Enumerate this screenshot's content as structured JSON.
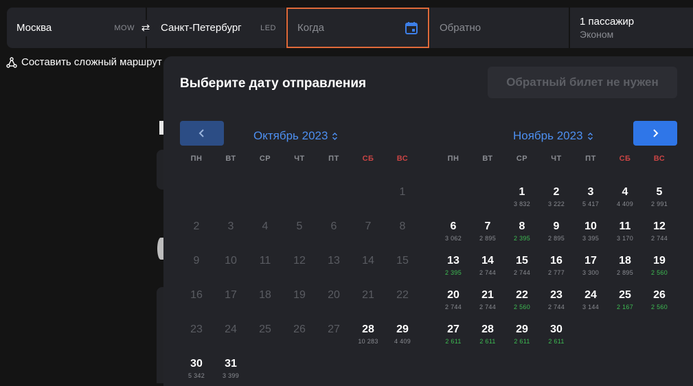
{
  "search": {
    "origin": {
      "city": "Москва",
      "code": "MOW"
    },
    "destination": {
      "city": "Санкт-Петербург",
      "code": "LED"
    },
    "when_placeholder": "Когда",
    "return_placeholder": "Обратно",
    "passengers": {
      "count_label": "1 пассажир",
      "class_label": "Эконом"
    },
    "swap_icon": "⇄",
    "complex_route_label": "Составить сложный маршрут"
  },
  "calendar": {
    "title": "Выберите дату отправления",
    "no_return_label": "Обратный билет не нужен",
    "weekdays": [
      "ПН",
      "ВТ",
      "СР",
      "ЧТ",
      "ПТ",
      "СБ",
      "ВС"
    ],
    "accent_color": "#4d8ff0",
    "price_cheap_color": "#3dbb52",
    "weekend_color": "#c94444",
    "months": [
      {
        "title": "Октябрь 2023",
        "weeks": [
          [
            null,
            null,
            null,
            null,
            null,
            null,
            {
              "d": "1",
              "disabled": true
            }
          ],
          [
            {
              "d": "2",
              "disabled": true
            },
            {
              "d": "3",
              "disabled": true
            },
            {
              "d": "4",
              "disabled": true
            },
            {
              "d": "5",
              "disabled": true
            },
            {
              "d": "6",
              "disabled": true
            },
            {
              "d": "7",
              "disabled": true
            },
            {
              "d": "8",
              "disabled": true
            }
          ],
          [
            {
              "d": "9",
              "disabled": true
            },
            {
              "d": "10",
              "disabled": true
            },
            {
              "d": "11",
              "disabled": true
            },
            {
              "d": "12",
              "disabled": true
            },
            {
              "d": "13",
              "disabled": true
            },
            {
              "d": "14",
              "disabled": true
            },
            {
              "d": "15",
              "disabled": true
            }
          ],
          [
            {
              "d": "16",
              "disabled": true
            },
            {
              "d": "17",
              "disabled": true
            },
            {
              "d": "18",
              "disabled": true
            },
            {
              "d": "19",
              "disabled": true
            },
            {
              "d": "20",
              "disabled": true
            },
            {
              "d": "21",
              "disabled": true
            },
            {
              "d": "22",
              "disabled": true
            }
          ],
          [
            {
              "d": "23",
              "disabled": true
            },
            {
              "d": "24",
              "disabled": true
            },
            {
              "d": "25",
              "disabled": true
            },
            {
              "d": "26",
              "disabled": true
            },
            {
              "d": "27",
              "disabled": true
            },
            {
              "d": "28",
              "p": "10 283"
            },
            {
              "d": "29",
              "p": "4 409"
            }
          ],
          [
            {
              "d": "30",
              "p": "5 342"
            },
            {
              "d": "31",
              "p": "3 399"
            },
            null,
            null,
            null,
            null,
            null
          ]
        ]
      },
      {
        "title": "Ноябрь 2023",
        "weeks": [
          [
            null,
            null,
            {
              "d": "1",
              "p": "3 832"
            },
            {
              "d": "2",
              "p": "3 222"
            },
            {
              "d": "3",
              "p": "5 417"
            },
            {
              "d": "4",
              "p": "4 409"
            },
            {
              "d": "5",
              "p": "2 991"
            }
          ],
          [
            {
              "d": "6",
              "p": "3 062"
            },
            {
              "d": "7",
              "p": "2 895"
            },
            {
              "d": "8",
              "p": "2 395",
              "cheap": true
            },
            {
              "d": "9",
              "p": "2 895"
            },
            {
              "d": "10",
              "p": "3 395"
            },
            {
              "d": "11",
              "p": "3 170"
            },
            {
              "d": "12",
              "p": "2 744"
            }
          ],
          [
            {
              "d": "13",
              "p": "2 395",
              "cheap": true
            },
            {
              "d": "14",
              "p": "2 744"
            },
            {
              "d": "15",
              "p": "2 744"
            },
            {
              "d": "16",
              "p": "2 777"
            },
            {
              "d": "17",
              "p": "3 300"
            },
            {
              "d": "18",
              "p": "2 895"
            },
            {
              "d": "19",
              "p": "2 560",
              "cheap": true
            }
          ],
          [
            {
              "d": "20",
              "p": "2 744"
            },
            {
              "d": "21",
              "p": "2 744"
            },
            {
              "d": "22",
              "p": "2 560",
              "cheap": true
            },
            {
              "d": "23",
              "p": "2 744"
            },
            {
              "d": "24",
              "p": "3 144"
            },
            {
              "d": "25",
              "p": "2 167",
              "cheap": true
            },
            {
              "d": "26",
              "p": "2 560",
              "cheap": true
            }
          ],
          [
            {
              "d": "27",
              "p": "2 611",
              "cheap": true
            },
            {
              "d": "28",
              "p": "2 611",
              "cheap": true
            },
            {
              "d": "29",
              "p": "2 611",
              "cheap": true
            },
            {
              "d": "30",
              "p": "2 611",
              "cheap": true
            },
            null,
            null,
            null
          ]
        ]
      }
    ]
  }
}
